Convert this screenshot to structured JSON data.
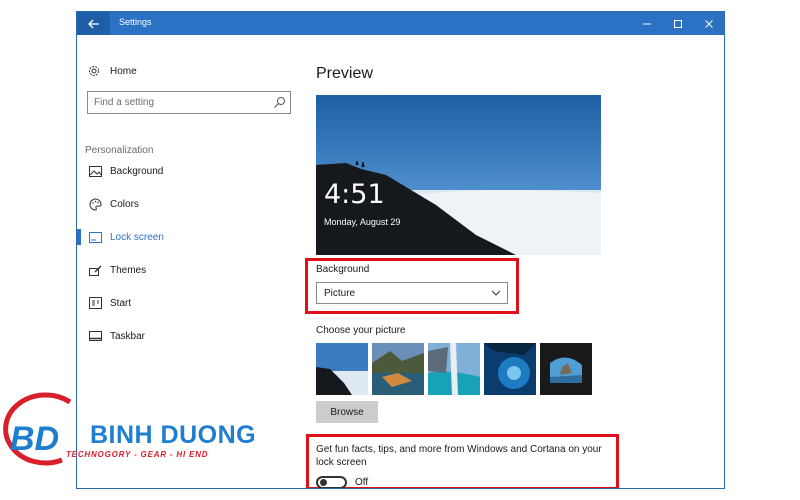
{
  "window": {
    "title": "Settings"
  },
  "sidebar": {
    "home_label": "Home",
    "search_placeholder": "Find a setting",
    "section_label": "Personalization",
    "items": [
      {
        "label": "Background",
        "icon": "picture-icon"
      },
      {
        "label": "Colors",
        "icon": "palette-icon"
      },
      {
        "label": "Lock screen",
        "icon": "lock-screen-icon",
        "active": true
      },
      {
        "label": "Themes",
        "icon": "brush-icon"
      },
      {
        "label": "Start",
        "icon": "start-menu-icon"
      },
      {
        "label": "Taskbar",
        "icon": "taskbar-icon"
      }
    ]
  },
  "content": {
    "preview_title": "Preview",
    "preview_time": "4:51",
    "preview_date": "Monday, August 29",
    "background_label": "Background",
    "background_value": "Picture",
    "choose_picture_label": "Choose your picture",
    "browse_label": "Browse",
    "fun_facts_label": "Get fun facts, tips, and more from Windows and Cortana on your lock screen",
    "toggle_state": "Off"
  },
  "watermark": {
    "brand": "BINH DUONG",
    "tagline": "TECHNOGORY - GEAR - HI END",
    "monogram": "BD"
  },
  "colors": {
    "accent": "#2b72c4",
    "highlight_box": "#e0101a",
    "brand_blue": "#1e7fd1",
    "brand_red": "#d81f2a"
  }
}
